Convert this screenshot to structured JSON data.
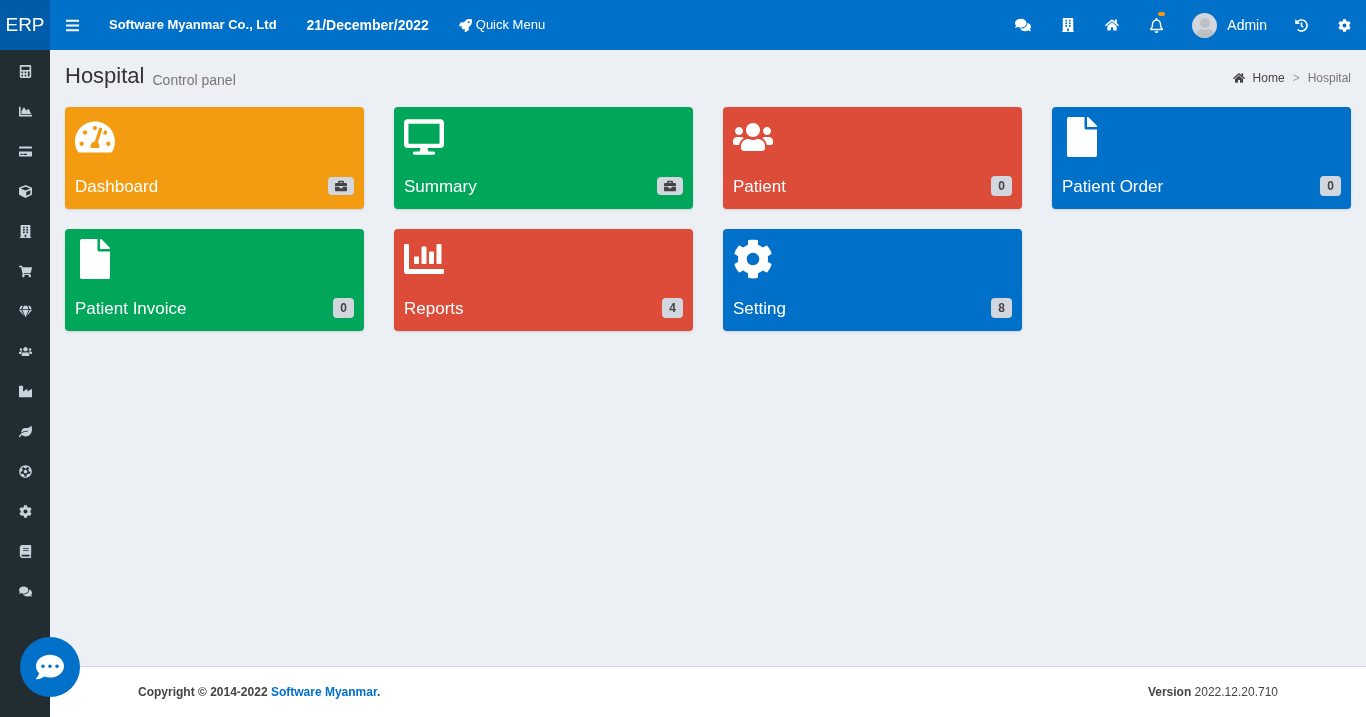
{
  "brand": "ERP",
  "header": {
    "company": "Software Myanmar Co., Ltd",
    "date": "21/December/2022",
    "quick_menu": "Quick Menu",
    "user": "Admin",
    "notifications_unread": true
  },
  "sidebar": {
    "items": [
      {
        "kind": "calculator"
      },
      {
        "kind": "chart"
      },
      {
        "kind": "card"
      },
      {
        "kind": "cube"
      },
      {
        "kind": "building"
      },
      {
        "kind": "cart"
      },
      {
        "kind": "diamond"
      },
      {
        "kind": "users"
      },
      {
        "kind": "industry"
      },
      {
        "kind": "leaf"
      },
      {
        "kind": "ball"
      },
      {
        "kind": "gear"
      },
      {
        "kind": "book"
      },
      {
        "kind": "comments"
      }
    ]
  },
  "page": {
    "title": "Hospital",
    "subtitle": "Control panel",
    "breadcrumb": [
      {
        "label": "Home",
        "kind": "home"
      },
      {
        "label": "Hospital",
        "kind": "current"
      }
    ],
    "breadcrumb_separator": ">"
  },
  "tiles": [
    {
      "label": "Dashboard",
      "kind": "gauge",
      "color": "#f39c12",
      "badge": {
        "kind": "icon"
      }
    },
    {
      "label": "Summary",
      "kind": "desktop",
      "color": "#00a65a",
      "badge": {
        "kind": "icon"
      }
    },
    {
      "label": "Patient",
      "kind": "users",
      "color": "#dd4b39",
      "badge": {
        "kind": "count",
        "text": "0"
      }
    },
    {
      "label": "Patient Order",
      "kind": "file",
      "color": "#0070c9",
      "badge": {
        "kind": "count",
        "text": "0"
      }
    },
    {
      "label": "Patient Invoice",
      "kind": "file",
      "color": "#00a65a",
      "badge": {
        "kind": "count",
        "text": "0"
      }
    },
    {
      "label": "Reports",
      "kind": "bars",
      "color": "#dd4b39",
      "badge": {
        "kind": "count",
        "text": "4"
      }
    },
    {
      "label": "Setting",
      "kind": "gear",
      "color": "#0070c9",
      "badge": {
        "kind": "count",
        "text": "8"
      }
    }
  ],
  "footer": {
    "copyright": "Copyright © 2014-2022",
    "link": "Software Myanmar",
    "after_link": ".",
    "version": "**Version** 2022.12.20.710"
  }
}
